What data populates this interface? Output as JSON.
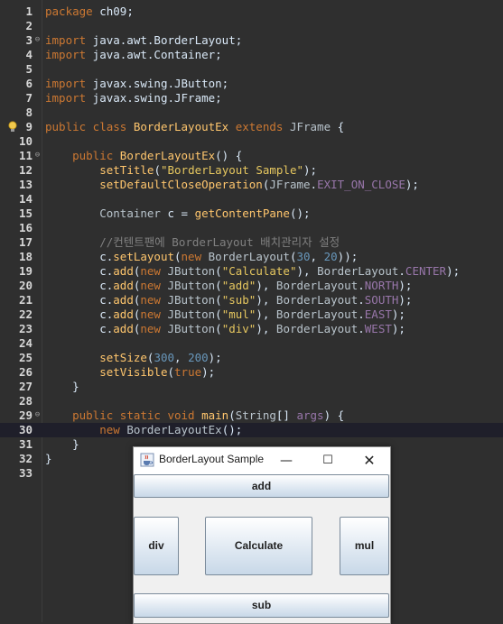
{
  "editor": {
    "lines": [
      {
        "n": "1",
        "tokens": [
          [
            "kw",
            "package"
          ],
          [
            "plain",
            " ch09;"
          ]
        ]
      },
      {
        "n": "2",
        "tokens": []
      },
      {
        "n": "3",
        "fold": true,
        "tokens": [
          [
            "kw",
            "import"
          ],
          [
            "plain",
            " java.awt.BorderLayout;"
          ]
        ]
      },
      {
        "n": "4",
        "tokens": [
          [
            "kw",
            "import"
          ],
          [
            "plain",
            " java.awt.Container;"
          ]
        ]
      },
      {
        "n": "5",
        "tokens": []
      },
      {
        "n": "6",
        "tokens": [
          [
            "kw",
            "import"
          ],
          [
            "plain",
            " javax.swing.JButton;"
          ]
        ]
      },
      {
        "n": "7",
        "tokens": [
          [
            "kw",
            "import"
          ],
          [
            "plain",
            " javax.swing.JFrame;"
          ]
        ]
      },
      {
        "n": "8",
        "tokens": []
      },
      {
        "n": "9",
        "bulb": true,
        "tokens": [
          [
            "kw",
            "public class "
          ],
          [
            "fn",
            "BorderLayoutEx"
          ],
          [
            "kw",
            " extends "
          ],
          [
            "ty",
            "JFrame"
          ],
          [
            "plain",
            " {"
          ]
        ]
      },
      {
        "n": "10",
        "tokens": []
      },
      {
        "n": "11",
        "fold": true,
        "tokens": [
          [
            "plain",
            "    "
          ],
          [
            "kw",
            "public "
          ],
          [
            "fn",
            "BorderLayoutEx"
          ],
          [
            "plain",
            "() {"
          ]
        ]
      },
      {
        "n": "12",
        "tokens": [
          [
            "plain",
            "        "
          ],
          [
            "fn",
            "setTitle"
          ],
          [
            "plain",
            "("
          ],
          [
            "str",
            "\"BorderLayout Sample\""
          ],
          [
            "plain",
            ");"
          ]
        ]
      },
      {
        "n": "13",
        "tokens": [
          [
            "plain",
            "        "
          ],
          [
            "fn",
            "setDefaultCloseOperation"
          ],
          [
            "plain",
            "("
          ],
          [
            "ty",
            "JFrame"
          ],
          [
            "plain",
            "."
          ],
          [
            "field",
            "EXIT_ON_CLOSE"
          ],
          [
            "plain",
            ");"
          ]
        ]
      },
      {
        "n": "14",
        "tokens": []
      },
      {
        "n": "15",
        "tokens": [
          [
            "plain",
            "        "
          ],
          [
            "ty",
            "Container"
          ],
          [
            "plain",
            " c = "
          ],
          [
            "fn",
            "getContentPane"
          ],
          [
            "plain",
            "();"
          ]
        ]
      },
      {
        "n": "16",
        "tokens": []
      },
      {
        "n": "17",
        "tokens": [
          [
            "plain",
            "        "
          ],
          [
            "cmt",
            "//컨텐트팬에 BorderLayout 배치관리자 설정"
          ]
        ]
      },
      {
        "n": "18",
        "tokens": [
          [
            "plain",
            "        c."
          ],
          [
            "fn",
            "setLayout"
          ],
          [
            "plain",
            "("
          ],
          [
            "kw",
            "new "
          ],
          [
            "ty",
            "BorderLayout"
          ],
          [
            "plain",
            "("
          ],
          [
            "num",
            "30"
          ],
          [
            "plain",
            ", "
          ],
          [
            "num",
            "20"
          ],
          [
            "plain",
            "));"
          ]
        ]
      },
      {
        "n": "19",
        "tokens": [
          [
            "plain",
            "        c."
          ],
          [
            "fn",
            "add"
          ],
          [
            "plain",
            "("
          ],
          [
            "kw",
            "new "
          ],
          [
            "ty",
            "JButton"
          ],
          [
            "plain",
            "("
          ],
          [
            "str",
            "\"Calculate\""
          ],
          [
            "plain",
            "), "
          ],
          [
            "ty",
            "BorderLayout"
          ],
          [
            "plain",
            "."
          ],
          [
            "field",
            "CENTER"
          ],
          [
            "plain",
            ");"
          ]
        ]
      },
      {
        "n": "20",
        "tokens": [
          [
            "plain",
            "        c."
          ],
          [
            "fn",
            "add"
          ],
          [
            "plain",
            "("
          ],
          [
            "kw",
            "new "
          ],
          [
            "ty",
            "JButton"
          ],
          [
            "plain",
            "("
          ],
          [
            "str",
            "\"add\""
          ],
          [
            "plain",
            "), "
          ],
          [
            "ty",
            "BorderLayout"
          ],
          [
            "plain",
            "."
          ],
          [
            "field",
            "NORTH"
          ],
          [
            "plain",
            ");"
          ]
        ]
      },
      {
        "n": "21",
        "tokens": [
          [
            "plain",
            "        c."
          ],
          [
            "fn",
            "add"
          ],
          [
            "plain",
            "("
          ],
          [
            "kw",
            "new "
          ],
          [
            "ty",
            "JButton"
          ],
          [
            "plain",
            "("
          ],
          [
            "str",
            "\"sub\""
          ],
          [
            "plain",
            "), "
          ],
          [
            "ty",
            "BorderLayout"
          ],
          [
            "plain",
            "."
          ],
          [
            "field",
            "SOUTH"
          ],
          [
            "plain",
            ");"
          ]
        ]
      },
      {
        "n": "22",
        "tokens": [
          [
            "plain",
            "        c."
          ],
          [
            "fn",
            "add"
          ],
          [
            "plain",
            "("
          ],
          [
            "kw",
            "new "
          ],
          [
            "ty",
            "JButton"
          ],
          [
            "plain",
            "("
          ],
          [
            "str",
            "\"mul\""
          ],
          [
            "plain",
            "), "
          ],
          [
            "ty",
            "BorderLayout"
          ],
          [
            "plain",
            "."
          ],
          [
            "field",
            "EAST"
          ],
          [
            "plain",
            ");"
          ]
        ]
      },
      {
        "n": "23",
        "tokens": [
          [
            "plain",
            "        c."
          ],
          [
            "fn",
            "add"
          ],
          [
            "plain",
            "("
          ],
          [
            "kw",
            "new "
          ],
          [
            "ty",
            "JButton"
          ],
          [
            "plain",
            "("
          ],
          [
            "str",
            "\"div\""
          ],
          [
            "plain",
            "), "
          ],
          [
            "ty",
            "BorderLayout"
          ],
          [
            "plain",
            "."
          ],
          [
            "field",
            "WEST"
          ],
          [
            "plain",
            ");"
          ]
        ]
      },
      {
        "n": "24",
        "tokens": []
      },
      {
        "n": "25",
        "tokens": [
          [
            "plain",
            "        "
          ],
          [
            "fn",
            "setSize"
          ],
          [
            "plain",
            "("
          ],
          [
            "num",
            "300"
          ],
          [
            "plain",
            ", "
          ],
          [
            "num",
            "200"
          ],
          [
            "plain",
            ");"
          ]
        ]
      },
      {
        "n": "26",
        "tokens": [
          [
            "plain",
            "        "
          ],
          [
            "fn",
            "setVisible"
          ],
          [
            "plain",
            "("
          ],
          [
            "kw",
            "true"
          ],
          [
            "plain",
            ");"
          ]
        ]
      },
      {
        "n": "27",
        "tokens": [
          [
            "plain",
            "    }"
          ]
        ]
      },
      {
        "n": "28",
        "tokens": []
      },
      {
        "n": "29",
        "fold": true,
        "tokens": [
          [
            "plain",
            "    "
          ],
          [
            "kw",
            "public static void "
          ],
          [
            "fn",
            "main"
          ],
          [
            "plain",
            "("
          ],
          [
            "ty",
            "String"
          ],
          [
            "plain",
            "[] "
          ],
          [
            "field",
            "args"
          ],
          [
            "plain",
            ") {"
          ]
        ]
      },
      {
        "n": "30",
        "current": true,
        "tokens": [
          [
            "plain",
            "        "
          ],
          [
            "kw",
            "new "
          ],
          [
            "ty",
            "BorderLayoutEx"
          ],
          [
            "plain",
            "();"
          ]
        ]
      },
      {
        "n": "31",
        "tokens": [
          [
            "plain",
            "    }"
          ]
        ]
      },
      {
        "n": "32",
        "tokens": [
          [
            "plain",
            "}"
          ]
        ]
      },
      {
        "n": "33",
        "tokens": []
      }
    ]
  },
  "window": {
    "title": "BorderLayout Sample",
    "icon": "java-cup-icon",
    "minimize_glyph": "—",
    "maximize_glyph": "☐",
    "close_glyph": "✕",
    "buttons": {
      "north": "add",
      "west": "div",
      "center": "Calculate",
      "east": "mul",
      "south": "sub"
    }
  },
  "colors": {
    "editor_bg": "#2f2f2f",
    "keyword": "#cc7832",
    "string": "#e6c75f",
    "number": "#6897bb",
    "method": "#ffc66d",
    "field": "#9876aa",
    "comment": "#808080"
  }
}
